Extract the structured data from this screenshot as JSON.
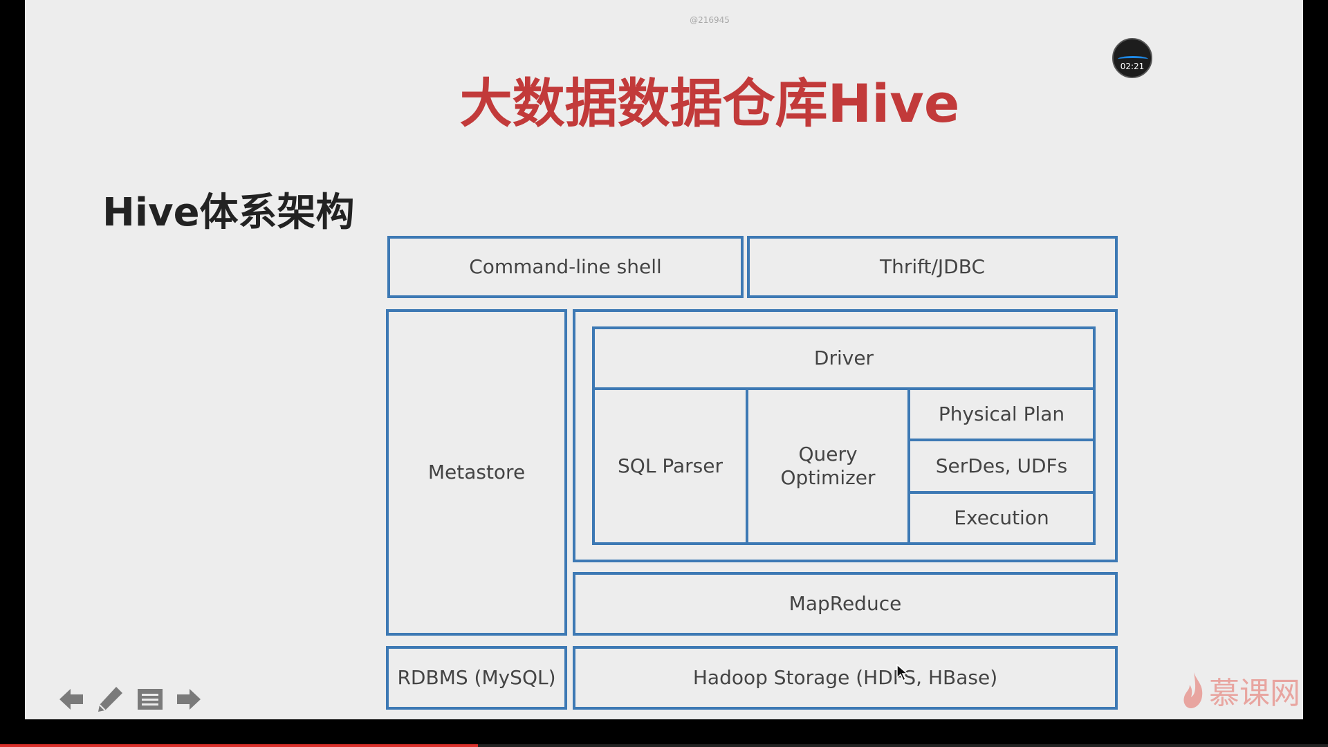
{
  "slide": {
    "watermark_id": "@216945",
    "timer": "02:21",
    "title": "大数据数据仓库Hive",
    "subtitle": "Hive体系架构"
  },
  "architecture": {
    "command_line_shell": "Command-line shell",
    "thrift_jdbc": "Thrift/JDBC",
    "metastore": "Metastore",
    "driver": "Driver",
    "sql_parser": "SQL Parser",
    "query_optimizer": "Query Optimizer",
    "physical_plan": "Physical Plan",
    "serdes_udfs": "SerDes, UDFs",
    "execution": "Execution",
    "mapreduce": "MapReduce",
    "rdbms": "RDBMS (MySQL)",
    "hadoop_storage": "Hadoop Storage (HDFS, HBase)"
  },
  "logo": {
    "text": "慕课网"
  },
  "playback": {
    "progress_fraction": 0.36
  },
  "colors": {
    "title_red": "#c23a3a",
    "box_blue": "#3d79b4",
    "progress_red": "#d9302b"
  },
  "icons": [
    "arrow-left-icon",
    "pencil-icon",
    "menu-icon",
    "arrow-right-icon",
    "flame-logo-icon"
  ]
}
